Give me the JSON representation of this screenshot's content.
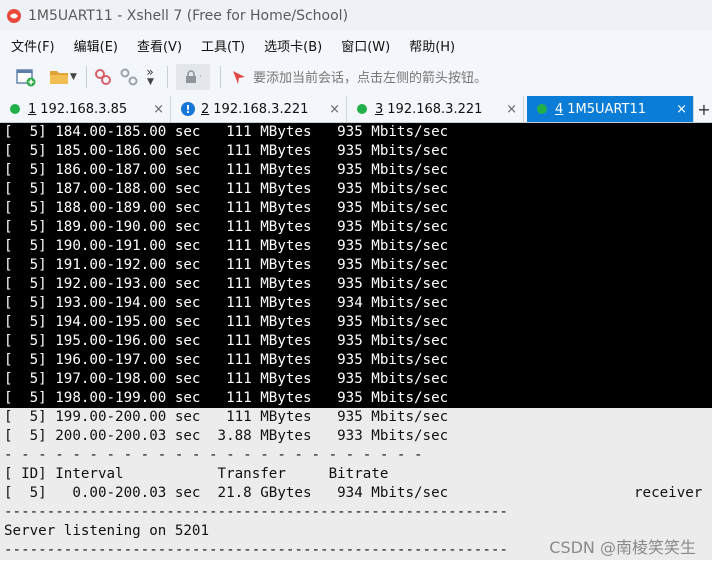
{
  "window": {
    "title": "1M5UART11 - Xshell 7 (Free for Home/School)"
  },
  "menu": [
    "文件(F)",
    "编辑(E)",
    "查看(V)",
    "工具(T)",
    "选项卡(B)",
    "窗口(W)",
    "帮助(H)"
  ],
  "toolbar": {
    "hint": "要添加当前会话，点击左侧的箭头按钮。"
  },
  "tabs": [
    {
      "num": "1",
      "label": "192.168.3.85",
      "status": "connected",
      "close": "×"
    },
    {
      "num": "2",
      "label": "192.168.3.221",
      "status": "warning",
      "close": "×"
    },
    {
      "num": "3",
      "label": "192.168.3.221",
      "status": "connected",
      "close": "×"
    },
    {
      "num": "4",
      "label": "1M5UART11",
      "status": "connected",
      "close": "×",
      "active": true
    }
  ],
  "tab_add": "+",
  "terminal": {
    "dark_lines": [
      "[  5] 184.00-185.00 sec   111 MBytes   935 Mbits/sec",
      "[  5] 185.00-186.00 sec   111 MBytes   935 Mbits/sec",
      "[  5] 186.00-187.00 sec   111 MBytes   935 Mbits/sec",
      "[  5] 187.00-188.00 sec   111 MBytes   935 Mbits/sec",
      "[  5] 188.00-189.00 sec   111 MBytes   935 Mbits/sec",
      "[  5] 189.00-190.00 sec   111 MBytes   935 Mbits/sec",
      "[  5] 190.00-191.00 sec   111 MBytes   935 Mbits/sec",
      "[  5] 191.00-192.00 sec   111 MBytes   935 Mbits/sec",
      "[  5] 192.00-193.00 sec   111 MBytes   935 Mbits/sec",
      "[  5] 193.00-194.00 sec   111 MBytes   934 Mbits/sec",
      "[  5] 194.00-195.00 sec   111 MBytes   935 Mbits/sec",
      "[  5] 195.00-196.00 sec   111 MBytes   935 Mbits/sec",
      "[  5] 196.00-197.00 sec   111 MBytes   935 Mbits/sec",
      "[  5] 197.00-198.00 sec   111 MBytes   935 Mbits/sec",
      "[  5] 198.00-199.00 sec   111 MBytes   935 Mbits/sec"
    ],
    "light_lines": [
      "[  5] 199.00-200.00 sec   111 MBytes   935 Mbits/sec",
      "[  5] 200.00-200.03 sec  3.88 MBytes   933 Mbits/sec",
      "- - - - - - - - - - - - - - - - - - - - - - - - -",
      "[ ID] Interval           Transfer     Bitrate",
      "[  5]   0.00-200.03 sec  21.8 GBytes   934 Mbits/sec",
      "-----------------------------------------------------------",
      "Server listening on 5201",
      "-----------------------------------------------------------"
    ],
    "receiver_label": "receiver"
  },
  "watermark": "CSDN @南棱笑笑生",
  "colors": {
    "active_tab": "#0b7dd6",
    "terminal_bg": "#000000",
    "terminal_fg": "#ffffff",
    "status_dot": "#22b04b"
  }
}
